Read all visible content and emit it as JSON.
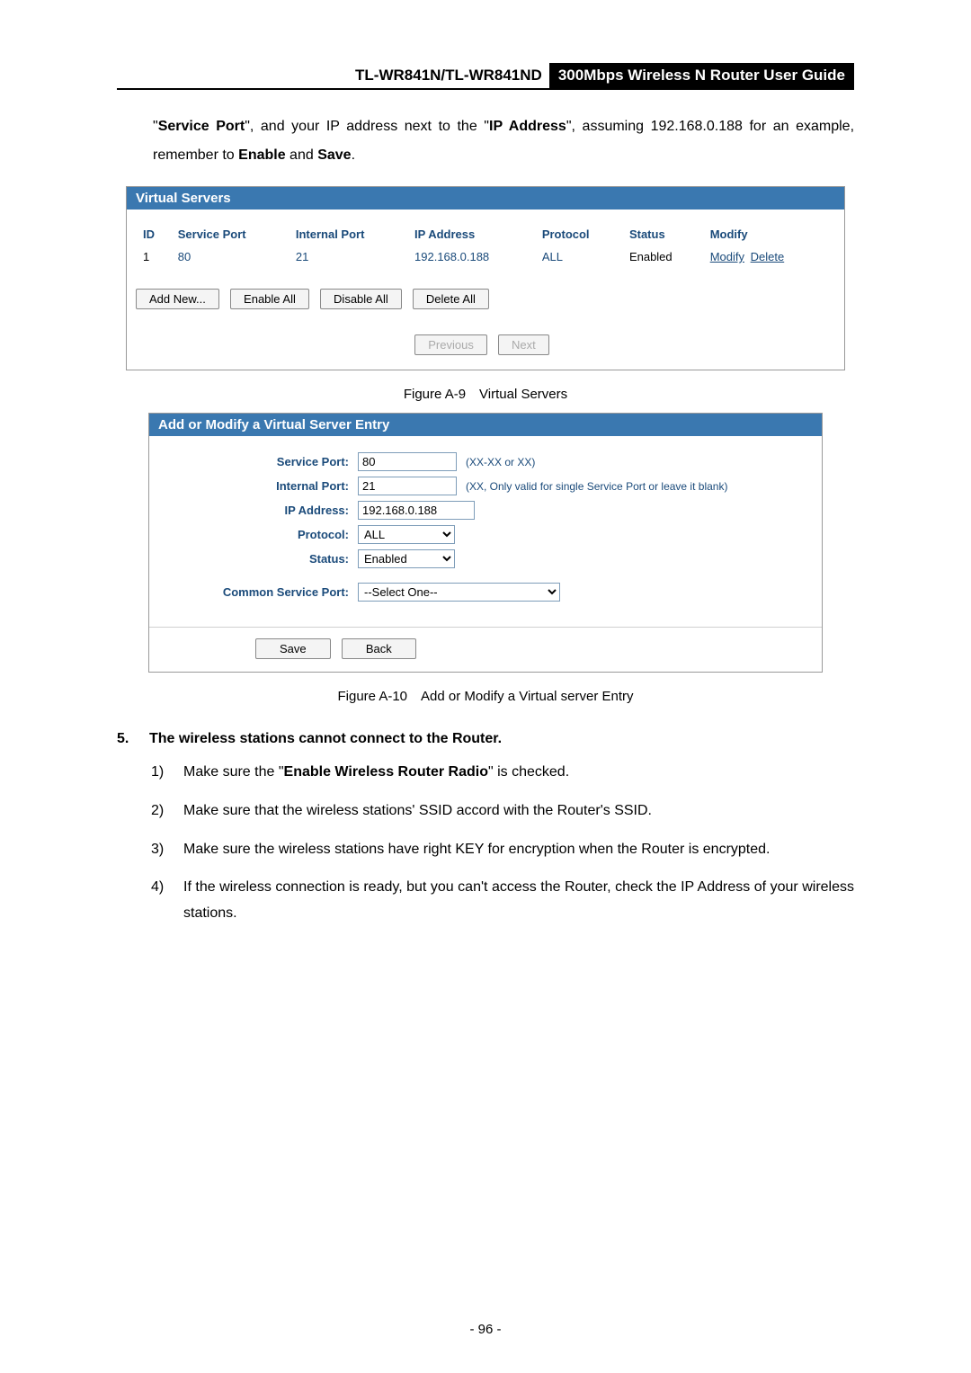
{
  "header": {
    "model": "TL-WR841N/TL-WR841ND",
    "guide": "300Mbps Wireless N Router User Guide"
  },
  "intro": {
    "pre1": "\"",
    "bold1": "Service Port",
    "mid1": "\", and your IP address next to the \"",
    "bold2": "IP Address",
    "mid2": "\", assuming 192.168.0.188 for an example, remember to ",
    "bold3": "Enable",
    "mid3": " and ",
    "bold4": "Save",
    "end": "."
  },
  "virtual_servers": {
    "title": "Virtual Servers",
    "headers": [
      "ID",
      "Service Port",
      "Internal Port",
      "IP Address",
      "Protocol",
      "Status",
      "Modify"
    ],
    "row": {
      "id": "1",
      "service_port": "80",
      "internal_port": "21",
      "ip": "192.168.0.188",
      "protocol": "ALL",
      "status": "Enabled",
      "modify": "Modify",
      "delete": "Delete"
    },
    "buttons": {
      "add_new": "Add New...",
      "enable_all": "Enable All",
      "disable_all": "Disable All",
      "delete_all": "Delete All",
      "previous": "Previous",
      "next": "Next"
    }
  },
  "captions": {
    "fig_a9": "Figure A-9 Virtual Servers",
    "fig_a10": "Figure A-10 Add or Modify a Virtual server Entry"
  },
  "form": {
    "title": "Add or Modify a Virtual Server Entry",
    "labels": {
      "service_port": "Service Port:",
      "internal_port": "Internal Port:",
      "ip": "IP Address:",
      "protocol": "Protocol:",
      "status": "Status:",
      "common": "Common Service Port:"
    },
    "values": {
      "service_port": "80",
      "internal_port": "21",
      "ip": "192.168.0.188",
      "protocol": "ALL",
      "status": "Enabled",
      "common": "--Select One--"
    },
    "hints": {
      "sp": "(XX-XX or XX)",
      "ip": "(XX, Only valid for single Service Port or leave it blank)"
    },
    "buttons": {
      "save": "Save",
      "back": "Back"
    }
  },
  "section5": {
    "num": "5.",
    "title": "The wireless stations cannot connect to the Router.",
    "items": [
      {
        "mk": "1)",
        "pre": "Make sure the \"",
        "bold": "Enable Wireless Router Radio",
        "post": "\" is checked."
      },
      {
        "mk": "2)",
        "txt": "Make sure that the wireless stations' SSID accord with the Router's SSID."
      },
      {
        "mk": "3)",
        "txt": "Make sure the wireless stations have right KEY for encryption when the Router is encrypted."
      },
      {
        "mk": "4)",
        "txt": "If the wireless connection is ready, but you can't access the Router, check the IP Address of your wireless stations."
      }
    ]
  },
  "page_num": "- 96 -"
}
